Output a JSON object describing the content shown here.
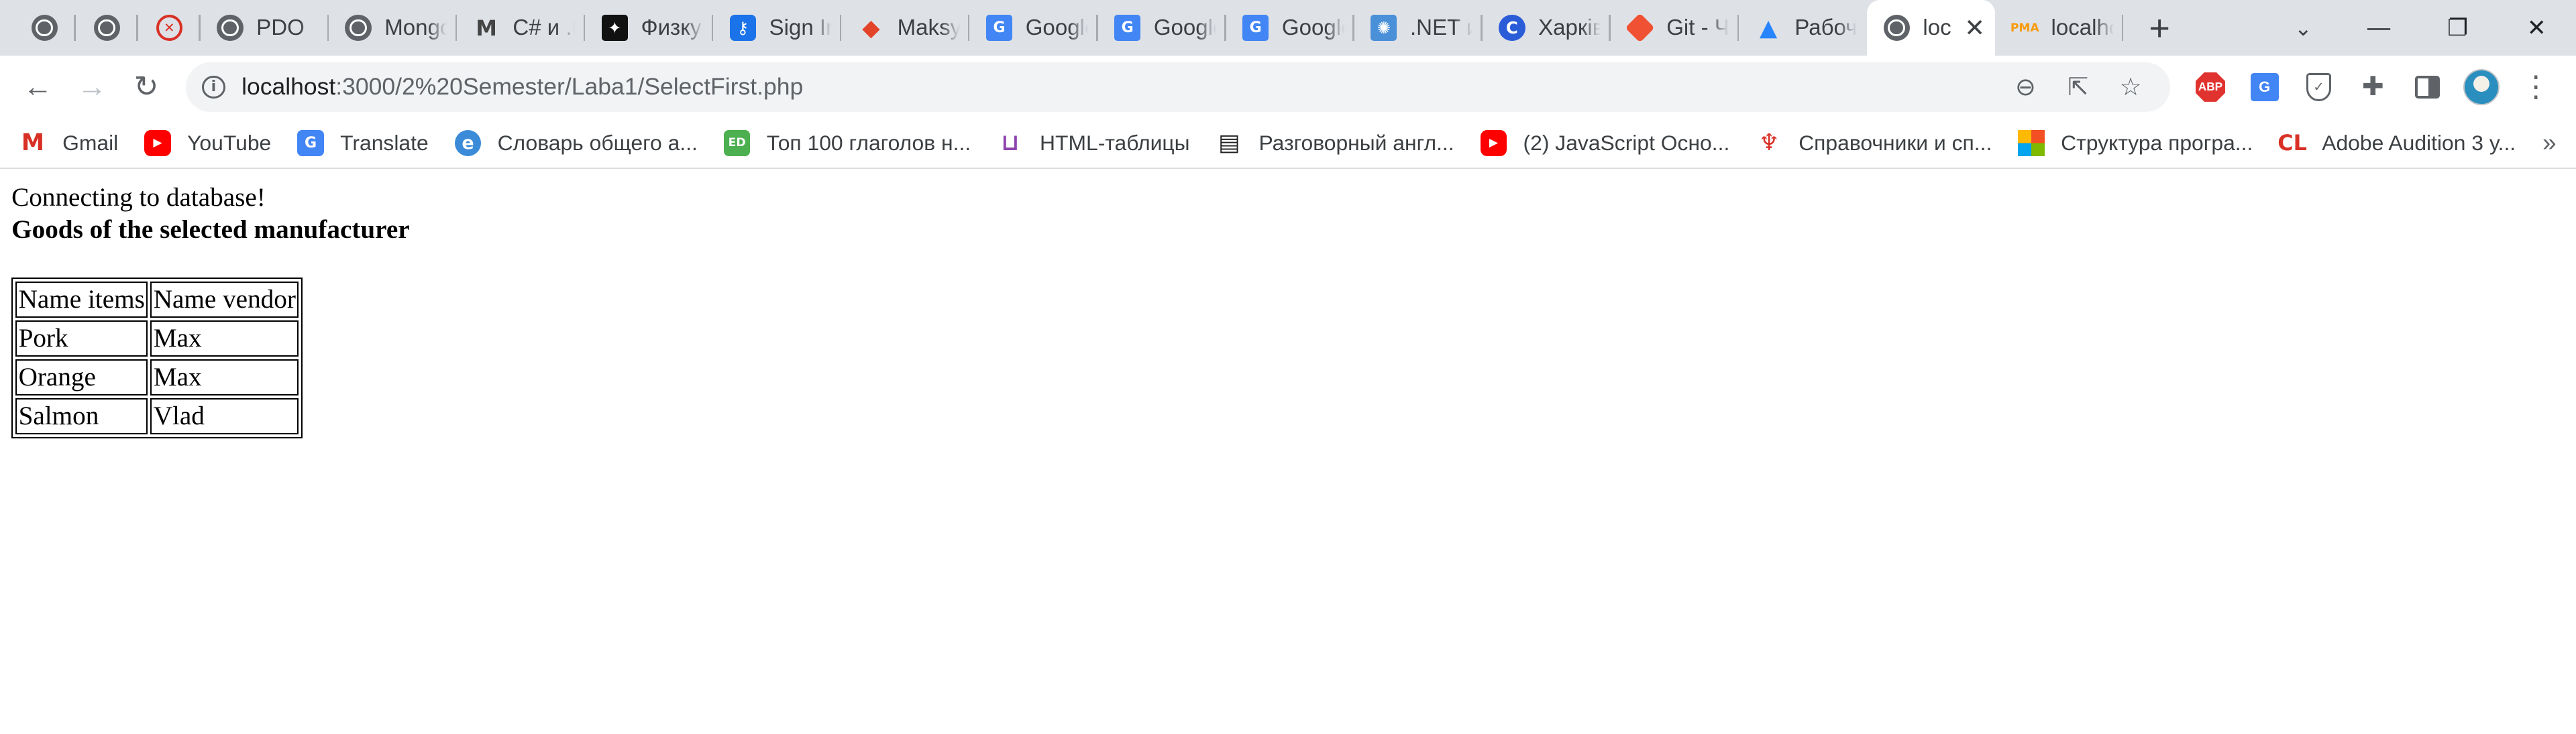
{
  "browser": {
    "tabs": [
      {
        "label": "",
        "icon": "globe-icon"
      },
      {
        "label": "",
        "icon": "globe-icon"
      },
      {
        "label": "",
        "icon": "red-ring-icon"
      },
      {
        "label": "PDO",
        "icon": "globe-icon"
      },
      {
        "label": "Mongo",
        "icon": "globe-icon"
      },
      {
        "label": "C# и .N",
        "icon": "gmail-m-icon"
      },
      {
        "label": "Физку",
        "icon": "dark-site-icon"
      },
      {
        "label": "Sign In",
        "icon": "key-icon"
      },
      {
        "label": "Maksy",
        "icon": "gitlab-icon"
      },
      {
        "label": "Google",
        "icon": "google-translate-icon"
      },
      {
        "label": "Google",
        "icon": "google-translate-icon"
      },
      {
        "label": "Google",
        "icon": "google-translate-icon"
      },
      {
        "label": ".NET и",
        "icon": "dotnet-icon"
      },
      {
        "label": "Харків",
        "icon": "c-logo-icon"
      },
      {
        "label": "Git - Ч",
        "icon": "git-icon"
      },
      {
        "label": "Рабоч",
        "icon": "atlassian-icon"
      },
      {
        "label": "loc",
        "icon": "globe-icon",
        "active": true
      },
      {
        "label": "localho",
        "icon": "phpmyadmin-icon"
      }
    ],
    "new_tab_symbol": "+",
    "address": {
      "host": "localhost",
      "path": ":3000/2%20Semester/Laba1/SelectFirst.php"
    },
    "bookmarks": [
      {
        "label": "Gmail",
        "icon": "gmail-icon"
      },
      {
        "label": "YouTube",
        "icon": "youtube-icon"
      },
      {
        "label": "Translate",
        "icon": "google-translate-icon"
      },
      {
        "label": "Словарь общего а...",
        "icon": "e-dictionary-icon"
      },
      {
        "label": "Топ 100 глаголов н...",
        "icon": "ed-icon"
      },
      {
        "label": "HTML-таблицы",
        "icon": "html-icon"
      },
      {
        "label": "Разговорный англ...",
        "icon": "scroll-icon"
      },
      {
        "label": "(2) JavaScript Осно...",
        "icon": "youtube-icon"
      },
      {
        "label": "Справочники и сп...",
        "icon": "tower-icon"
      },
      {
        "label": "Структура програ...",
        "icon": "microsoft-icon"
      },
      {
        "label": "Adobe Audition 3 у...",
        "icon": "cl-icon"
      }
    ]
  },
  "page": {
    "connect_text": "Connecting to database!",
    "heading": "Goods of the selected manufacturer",
    "table": {
      "headers": [
        "Name items",
        "Name vendor"
      ],
      "rows": [
        [
          "Pork",
          "Max"
        ],
        [
          "Orange",
          "Max"
        ],
        [
          "Salmon",
          "Vlad"
        ]
      ]
    }
  }
}
